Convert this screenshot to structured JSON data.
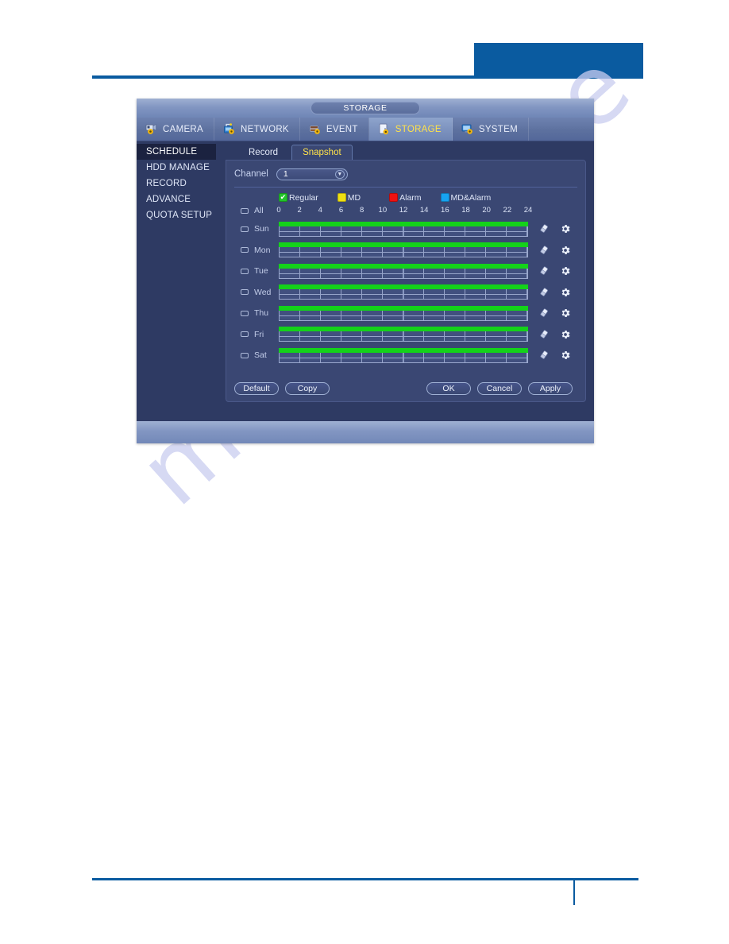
{
  "window": {
    "title": "STORAGE"
  },
  "top_tabs": [
    {
      "label": "CAMERA",
      "icon": "camera-gear-icon",
      "active": false
    },
    {
      "label": "NETWORK",
      "icon": "network-gear-icon",
      "active": false
    },
    {
      "label": "EVENT",
      "icon": "event-gear-icon",
      "active": false
    },
    {
      "label": "STORAGE",
      "icon": "storage-gear-icon",
      "active": true
    },
    {
      "label": "SYSTEM",
      "icon": "system-gear-icon",
      "active": false
    }
  ],
  "sidebar": {
    "items": [
      {
        "label": "SCHEDULE",
        "active": true
      },
      {
        "label": "HDD MANAGE",
        "active": false
      },
      {
        "label": "RECORD",
        "active": false
      },
      {
        "label": "ADVANCE",
        "active": false
      },
      {
        "label": "QUOTA SETUP",
        "active": false
      }
    ]
  },
  "sub_tabs": [
    {
      "label": "Record",
      "active": false
    },
    {
      "label": "Snapshot",
      "active": true
    }
  ],
  "channel": {
    "label": "Channel",
    "value": "1",
    "caret": "chevron-down-icon"
  },
  "legend": [
    {
      "label": "Regular",
      "color": "#22c32a",
      "checked": true
    },
    {
      "label": "MD",
      "color": "#efe013",
      "checked": false
    },
    {
      "label": "Alarm",
      "color": "#f01111",
      "checked": false
    },
    {
      "label": "MD&Alarm",
      "color": "#17a3f0",
      "checked": false
    }
  ],
  "schedule": {
    "axis_ticks": [
      "0",
      "2",
      "4",
      "6",
      "8",
      "10",
      "12",
      "14",
      "16",
      "18",
      "20",
      "22",
      "24"
    ],
    "all_label": "All",
    "row_icons": {
      "eraser": "eraser-icon",
      "setup": "gear-icon"
    },
    "rows": [
      {
        "day": "Sun",
        "checked": false,
        "coverage": "00:00-24:00",
        "type": "Regular"
      },
      {
        "day": "Mon",
        "checked": false,
        "coverage": "00:00-24:00",
        "type": "Regular"
      },
      {
        "day": "Tue",
        "checked": false,
        "coverage": "00:00-24:00",
        "type": "Regular"
      },
      {
        "day": "Wed",
        "checked": false,
        "coverage": "00:00-24:00",
        "type": "Regular"
      },
      {
        "day": "Thu",
        "checked": false,
        "coverage": "00:00-24:00",
        "type": "Regular"
      },
      {
        "day": "Fri",
        "checked": false,
        "coverage": "00:00-24:00",
        "type": "Regular"
      },
      {
        "day": "Sat",
        "checked": false,
        "coverage": "00:00-24:00",
        "type": "Regular"
      }
    ]
  },
  "buttons": {
    "default": "Default",
    "copy": "Copy",
    "ok": "OK",
    "cancel": "Cancel",
    "apply": "Apply"
  },
  "watermark": {
    "text": "manualshive"
  },
  "colors": {
    "accent_blue": "#0a5ba0",
    "bar_green": "#14d21a",
    "active_tab_text": "#ffe24a"
  }
}
